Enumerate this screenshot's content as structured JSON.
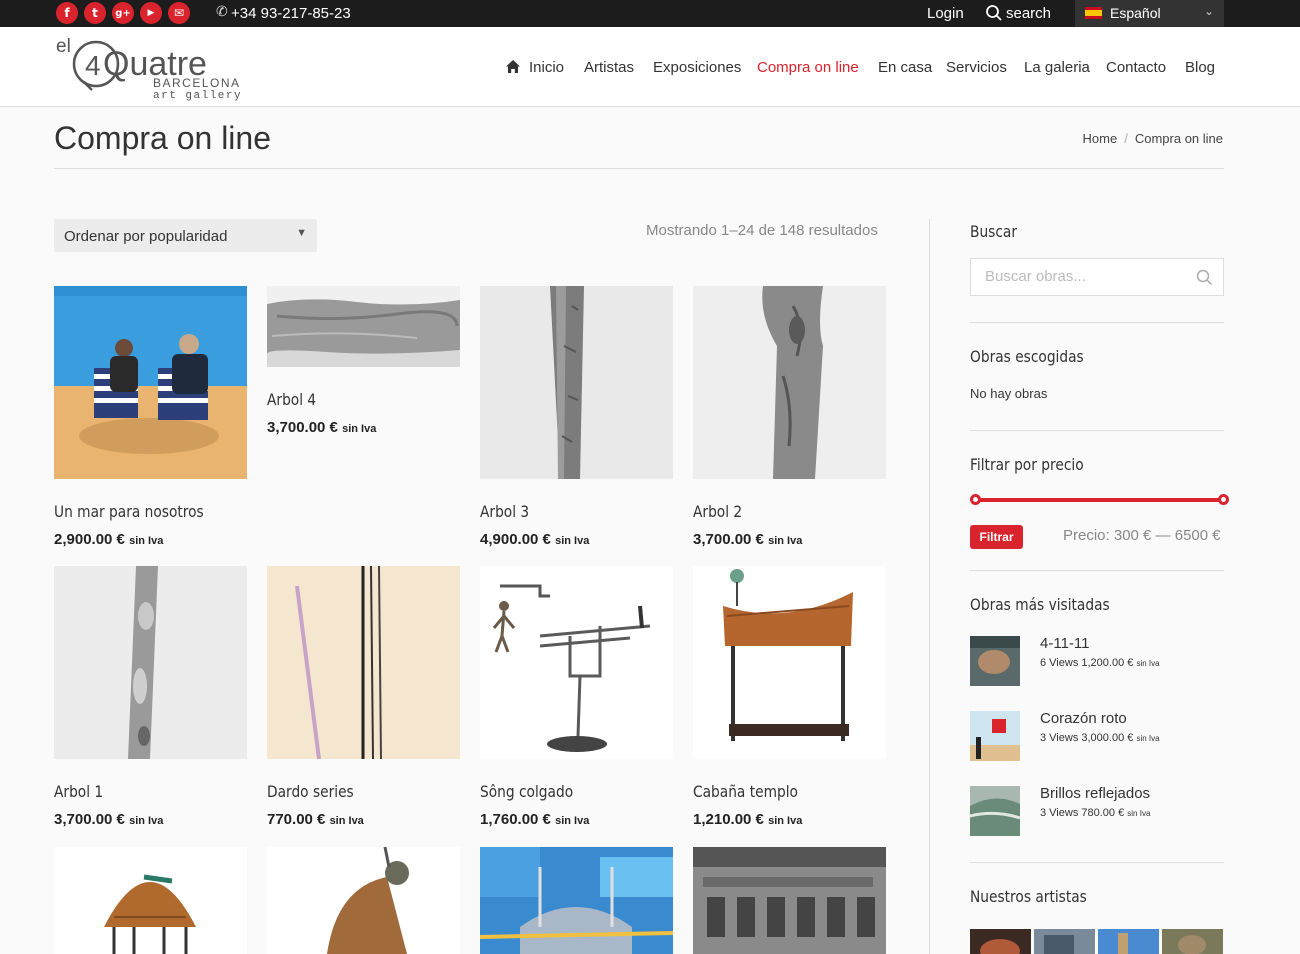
{
  "topbar": {
    "social": [
      {
        "name": "facebook-icon",
        "glyph": "f"
      },
      {
        "name": "twitter-icon",
        "glyph": "t"
      },
      {
        "name": "google-plus-icon",
        "glyph": "g+"
      },
      {
        "name": "youtube-icon",
        "glyph": "▶"
      },
      {
        "name": "email-icon",
        "glyph": "✉"
      }
    ],
    "phone": "+34 93-217-85-23",
    "login": "Login",
    "search": "search",
    "language": "Español"
  },
  "header": {
    "logo": {
      "line1": "el",
      "line2": "Quatre",
      "digit": "4",
      "line3": "BARCELONA",
      "line4": "art gallery"
    },
    "nav": [
      "Inicio",
      "Artistas",
      "Exposiciones",
      "Compra on line",
      "En casa",
      "Servicios",
      "La galeria",
      "Contacto",
      "Blog"
    ],
    "active_nav": "Compra on line"
  },
  "page": {
    "title": "Compra on line",
    "breadcrumb": [
      "Home",
      "Compra on line"
    ],
    "breadcrumb_sep": "/"
  },
  "toolbar": {
    "sort_label": "Ordenar por popularidad",
    "results": "Mostrando 1–24 de 148 resultados"
  },
  "products": [
    {
      "name": "Un mar para nosotros",
      "price": "2,900.00 €",
      "tax": "sin Iva"
    },
    {
      "name": "Arbol 4",
      "price": "3,700.00 €",
      "tax": "sin Iva"
    },
    {
      "name": "Arbol 3",
      "price": "4,900.00 €",
      "tax": "sin Iva"
    },
    {
      "name": "Arbol 2",
      "price": "3,700.00 €",
      "tax": "sin Iva"
    },
    {
      "name": "Arbol 1",
      "price": "3,700.00 €",
      "tax": "sin Iva"
    },
    {
      "name": "Dardo series",
      "price": "770.00 €",
      "tax": "sin Iva"
    },
    {
      "name": "Sông colgado",
      "price": "1,760.00 €",
      "tax": "sin Iva"
    },
    {
      "name": "Cabaña templo",
      "price": "1,210.00 €",
      "tax": "sin Iva"
    }
  ],
  "sidebar": {
    "search_title": "Buscar",
    "search_placeholder": "Buscar obras...",
    "chosen_title": "Obras escogidas",
    "chosen_empty": "No hay obras",
    "price_title": "Filtrar por precio",
    "filter_button": "Filtrar",
    "price_range": "Precio: 300 € — 6500 €",
    "most_visited_title": "Obras más visitadas",
    "most_visited": [
      {
        "name": "4-11-11",
        "meta": "6 Views 1,200.00 €",
        "tax": "sin Iva"
      },
      {
        "name": "Corazón roto",
        "meta": "3 Views 3,000.00 €",
        "tax": "sin Iva"
      },
      {
        "name": "Brillos reflejados",
        "meta": "3 Views 780.00 €",
        "tax": "sin Iva"
      }
    ],
    "artists_title": "Nuestros artistas"
  },
  "colors": {
    "accent": "#d9232d",
    "topbar": "#1c1c1c"
  }
}
